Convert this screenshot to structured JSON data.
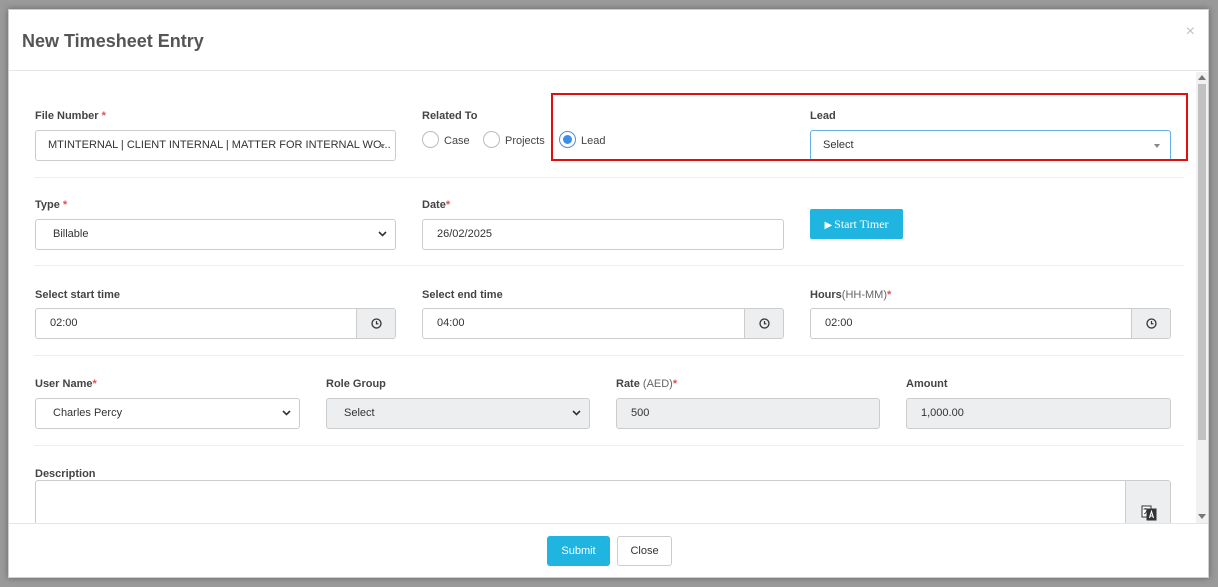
{
  "backdrop": {
    "text": "..."
  },
  "modal": {
    "title": "New Timesheet Entry",
    "close_glyph": "×"
  },
  "form": {
    "file_number": {
      "label": "File Number",
      "required": "*",
      "value": "MTINTERNAL | CLIENT INTERNAL | MATTER FOR INTERNAL WO..."
    },
    "related_to": {
      "label": "Related To",
      "options": [
        {
          "label": "Case",
          "checked": false
        },
        {
          "label": "Projects",
          "checked": false
        },
        {
          "label": "Lead",
          "checked": true
        }
      ]
    },
    "lead": {
      "label": "Lead",
      "value": "Select"
    },
    "type": {
      "label": "Type",
      "required": "*",
      "value": "Billable"
    },
    "date": {
      "label": "Date",
      "required": "*",
      "value": "26/02/2025"
    },
    "start_timer": {
      "label": "Start Timer"
    },
    "start_time": {
      "label": "Select start time",
      "value": "02:00"
    },
    "end_time": {
      "label": "Select end time",
      "value": "04:00"
    },
    "hours": {
      "label": "Hours",
      "unit": "(HH-MM)",
      "required": "*",
      "value": "02:00"
    },
    "user_name": {
      "label": "User Name",
      "required": "*",
      "value": "Charles Percy"
    },
    "role_group": {
      "label": "Role Group",
      "value": "Select"
    },
    "rate": {
      "label": "Rate",
      "unit": "(AED)",
      "required": "*",
      "value": "500"
    },
    "amount": {
      "label": "Amount",
      "value": "1,000.00"
    },
    "description": {
      "label": "Description",
      "value": ""
    }
  },
  "footer": {
    "submit_label": "Submit",
    "close_label": "Close"
  },
  "colors": {
    "accent": "#1fb5e0",
    "highlight": "#e01010",
    "required": "#d9534f",
    "radio_checked": "#3d8ee8"
  },
  "icons": [
    "clock-icon",
    "play-icon",
    "translate-icon",
    "close-icon",
    "chevron-down-icon",
    "caret-down-icon"
  ]
}
